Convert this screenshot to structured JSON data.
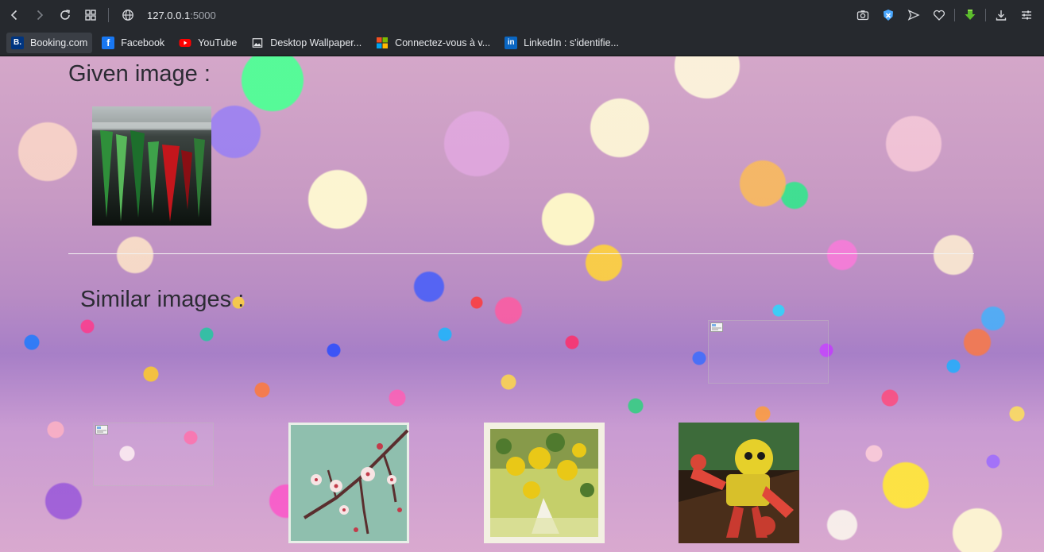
{
  "browser": {
    "url_host": "127.0.0.1",
    "url_port": ":5000",
    "bookmarks": [
      {
        "label": "Booking.com",
        "icon": "booking-icon",
        "color": "#003580"
      },
      {
        "label": "Facebook",
        "icon": "facebook-icon",
        "color": "#1877f2"
      },
      {
        "label": "YouTube",
        "icon": "youtube-icon",
        "color": "#ff0000"
      },
      {
        "label": "Desktop Wallpaper...",
        "icon": "image-icon",
        "color": "#e6e8eb"
      },
      {
        "label": "Connectez-vous à v...",
        "icon": "microsoft-icon",
        "color": "#f25022"
      },
      {
        "label": "LinkedIn : s'identifie...",
        "icon": "linkedin-icon",
        "color": "#0a66c2"
      }
    ]
  },
  "page": {
    "given_heading": "Given image :",
    "similar_heading": "Similar images :"
  }
}
